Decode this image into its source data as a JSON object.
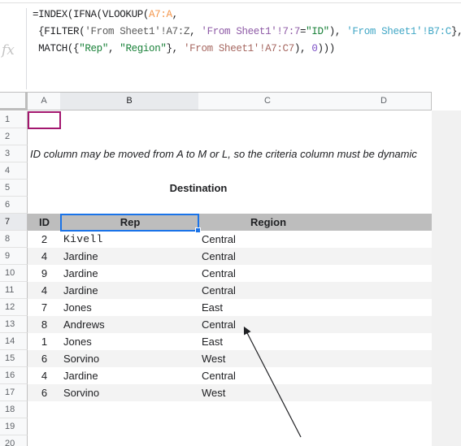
{
  "formula_bar": {
    "icon": "fx-icon",
    "icon_text": "fx",
    "lines": [
      [
        {
          "text": "=INDEX(IFNA(VLOOKUP(",
          "cls": ""
        },
        {
          "text": "A7:A",
          "cls": "tok-ref1"
        },
        {
          "text": ",",
          "cls": ""
        }
      ],
      [
        {
          "text": " {FILTER(",
          "cls": ""
        },
        {
          "text": "'From Sheet1'!A7:Z",
          "cls": "tok-ref2"
        },
        {
          "text": ", ",
          "cls": ""
        },
        {
          "text": "'From Sheet1'!7:7",
          "cls": "tok-ref3"
        },
        {
          "text": "=",
          "cls": ""
        },
        {
          "text": "\"ID\"",
          "cls": "tok-str"
        },
        {
          "text": "), ",
          "cls": ""
        },
        {
          "text": "'From Sheet1'!B7:C",
          "cls": "tok-ref4"
        },
        {
          "text": "},",
          "cls": ""
        }
      ],
      [
        {
          "text": " MATCH({",
          "cls": ""
        },
        {
          "text": "\"Rep\"",
          "cls": "tok-str"
        },
        {
          "text": ", ",
          "cls": ""
        },
        {
          "text": "\"Region\"",
          "cls": "tok-str"
        },
        {
          "text": "}, ",
          "cls": ""
        },
        {
          "text": "'From Sheet1'!A7:C7",
          "cls": "tok-ref5"
        },
        {
          "text": "), ",
          "cls": ""
        },
        {
          "text": "0",
          "cls": "tok-num"
        },
        {
          "text": ")))",
          "cls": ""
        }
      ]
    ]
  },
  "columns": [
    "A",
    "B",
    "C",
    "D"
  ],
  "selected_column": "B",
  "rows": [
    "1",
    "2",
    "3",
    "4",
    "5",
    "6",
    "7",
    "8",
    "9",
    "10",
    "11",
    "12",
    "13",
    "14",
    "15",
    "16",
    "17",
    "18",
    "19",
    "20"
  ],
  "selected_row": "7",
  "note": "ID column may be moved from A to M or L, so the criteria column must be dynamic",
  "destination_title": "Destination",
  "table": {
    "headers": {
      "id": "ID",
      "rep": "Rep",
      "region": "Region"
    },
    "rows": [
      {
        "id": "2",
        "rep": "Kivell",
        "region": "Central"
      },
      {
        "id": "4",
        "rep": "Jardine",
        "region": "Central"
      },
      {
        "id": "9",
        "rep": "Jardine",
        "region": "Central"
      },
      {
        "id": "4",
        "rep": "Jardine",
        "region": "Central"
      },
      {
        "id": "7",
        "rep": "Jones",
        "region": "East"
      },
      {
        "id": "8",
        "rep": "Andrews",
        "region": "Central"
      },
      {
        "id": "1",
        "rep": "Jones",
        "region": "East"
      },
      {
        "id": "6",
        "rep": "Sorvino",
        "region": "West"
      },
      {
        "id": "4",
        "rep": "Jardine",
        "region": "Central"
      },
      {
        "id": "6",
        "rep": "Sorvino",
        "region": "West"
      }
    ]
  },
  "colors": {
    "header_row_bg": "#bdbdbd",
    "alt_row_bg": "#f3f3f3",
    "active_cell_border": "#1a73e8",
    "collaborator_cell_border": "#a3176f"
  }
}
